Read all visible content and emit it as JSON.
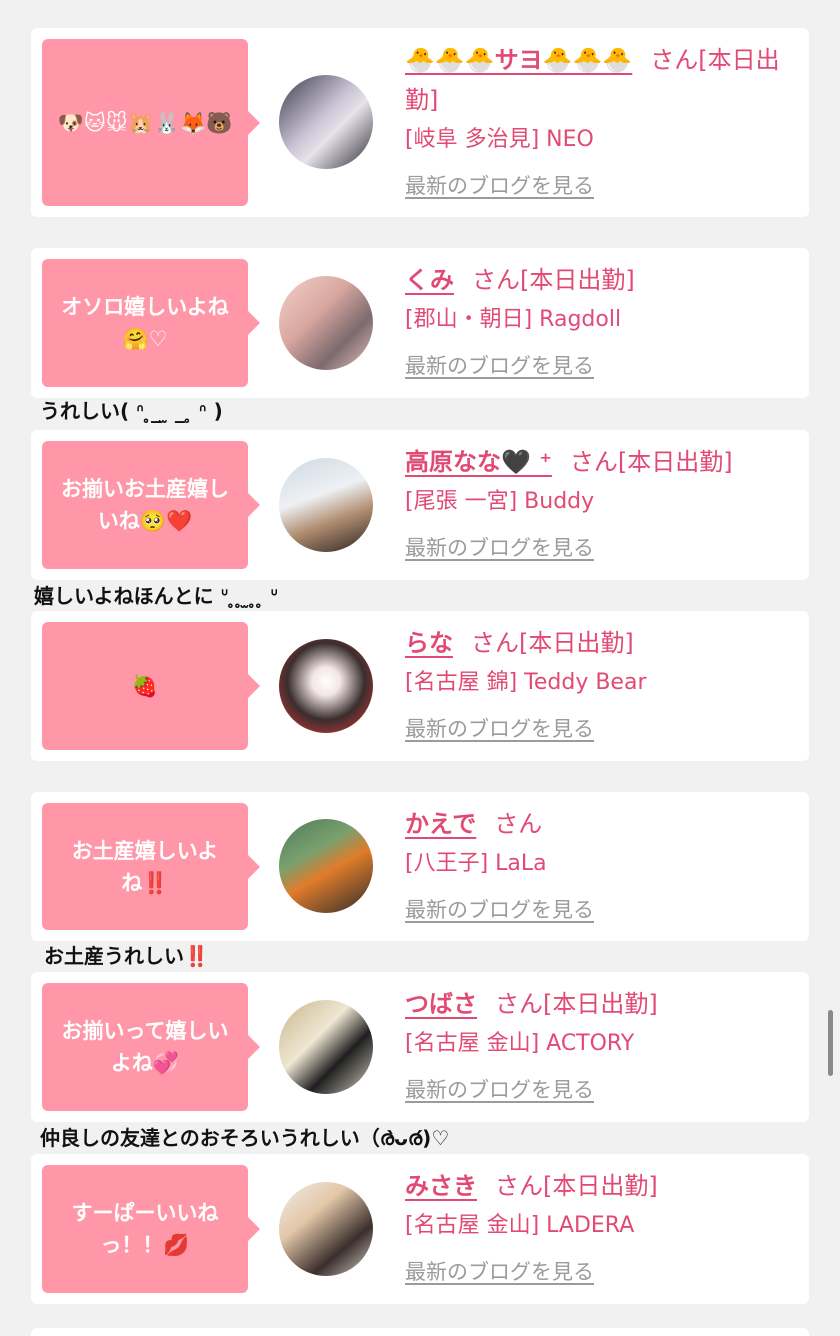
{
  "blog_link_label": "最新のブログを見る",
  "accent_color": "#e24a76",
  "bubble_color": "#ff97a8",
  "entries": [
    {
      "bubble": "🐶🐱🐭🐹🐰🦊🐻",
      "name": "🐣🐣🐣サヨ🐣🐣🐣",
      "suffix": "さん[本日出勤]",
      "shop": "[岐阜 多治見] NEO"
    },
    {
      "bubble": "オソロ嬉しいよね🤗♡",
      "name": "くみ",
      "suffix": "さん[本日出勤]",
      "shop": "[郡山・朝日] Ragdoll",
      "comment": "うれしい( ᐢ ̥_ ̫ _ ̥ ᐢ )"
    },
    {
      "bubble": "お揃いお土産嬉しいね🥺❤️",
      "name": "高原なな🖤 ⁺",
      "suffix": "さん[本日出勤]",
      "shop": "[尾張 一宮] Buddy",
      "comment": "嬉しいよねほんとに ᐡ ̥ ̥ ̫ ̥ ̥ ᐡ"
    },
    {
      "bubble": "🍓",
      "name": "らな",
      "suffix": "さん[本日出勤]",
      "shop": "[名古屋 錦] Teddy Bear"
    },
    {
      "bubble": "お土産嬉しいよね‼️",
      "name": "かえで",
      "suffix": "さん",
      "shop": "[八王子] LaLa",
      "comment": "お土産うれしい‼️"
    },
    {
      "bubble": "お揃いって嬉しいよね💞",
      "name": "つばさ",
      "suffix": "さん[本日出勤]",
      "shop": "[名古屋 金山] ACTORY",
      "comment": "仲良しの友達とのおそろいうれしい（ര̀ᴗര́)♡"
    },
    {
      "bubble": "すーぱーいいねっ！！💋",
      "name": "みさき",
      "suffix": "さん[本日出勤]",
      "shop": "[名古屋 金山] LADERA"
    }
  ]
}
